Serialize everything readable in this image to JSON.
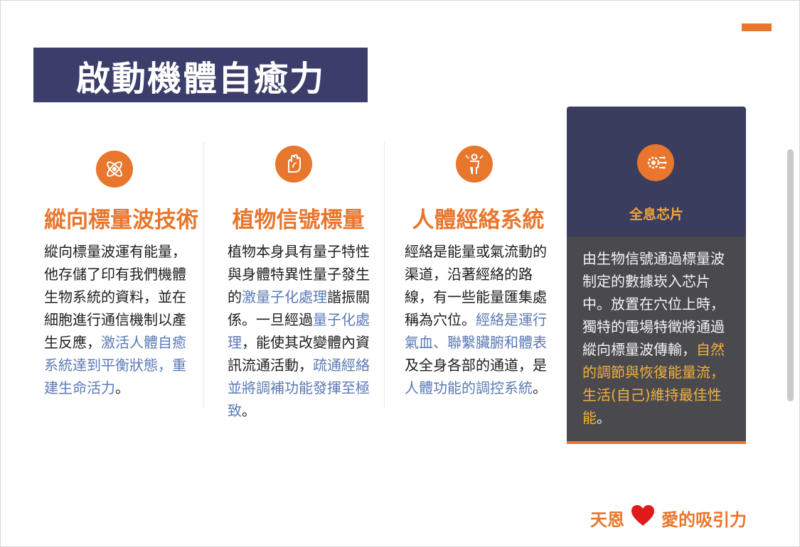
{
  "title": "啟動機體自癒力",
  "accent_color": "#e8762c",
  "columns": [
    {
      "icon": "atom-icon",
      "heading": "縱向標量波技術",
      "body_segments": [
        {
          "text": "縱向標量波運有能量，他存儲了印有我們機體生物系統的資料，並在細胞進行通信機制以產生反應，",
          "highlight": false
        },
        {
          "text": "激活人體自癒系統達到平衡狀態，重建生命活力",
          "highlight": true
        },
        {
          "text": "。",
          "highlight": false
        }
      ]
    },
    {
      "icon": "hand-plant-icon",
      "heading": "植物信號標量",
      "body_segments": [
        {
          "text": "植物本身具有量子特性與身體特異性量子發生的",
          "highlight": false
        },
        {
          "text": "激量子化處理",
          "highlight": true
        },
        {
          "text": "諧振關係。一旦經過",
          "highlight": false
        },
        {
          "text": "量子化處理",
          "highlight": true
        },
        {
          "text": "，能使其改變體內資訊流通活動，",
          "highlight": false
        },
        {
          "text": "疏通經絡並將調補功能發揮至極致",
          "highlight": true
        },
        {
          "text": "。",
          "highlight": false
        }
      ]
    },
    {
      "icon": "human-body-icon",
      "heading": "人體經絡系統",
      "body_segments": [
        {
          "text": "經絡是能量或氣流動的渠道，沿著經絡的路線，有一些能量匯集處稱為穴位。",
          "highlight": false
        },
        {
          "text": "經絡是運行氣血、聯繫臟腑和體表",
          "highlight": true
        },
        {
          "text": "及全身各部的通道，是",
          "highlight": false
        },
        {
          "text": "人體功能的調控系統",
          "highlight": true
        },
        {
          "text": "。",
          "highlight": false
        }
      ]
    }
  ],
  "card": {
    "icon": "chip-gear-icon",
    "heading": "全息芯片",
    "body_segments": [
      {
        "text": "由生物信號通過標量波制定的數據崁入芯片中。放置在穴位上時，獨特的電場特徵將通過縱向標量波傳輸，",
        "highlight": false
      },
      {
        "text": "自然的調節與恢復能量流，生活(自己)維持最佳性能",
        "highlight": true
      },
      {
        "text": "。",
        "highlight": false
      }
    ]
  },
  "brand": {
    "left": "天恩",
    "heart_icon": "heart-icon",
    "right": "愛的吸引力"
  }
}
